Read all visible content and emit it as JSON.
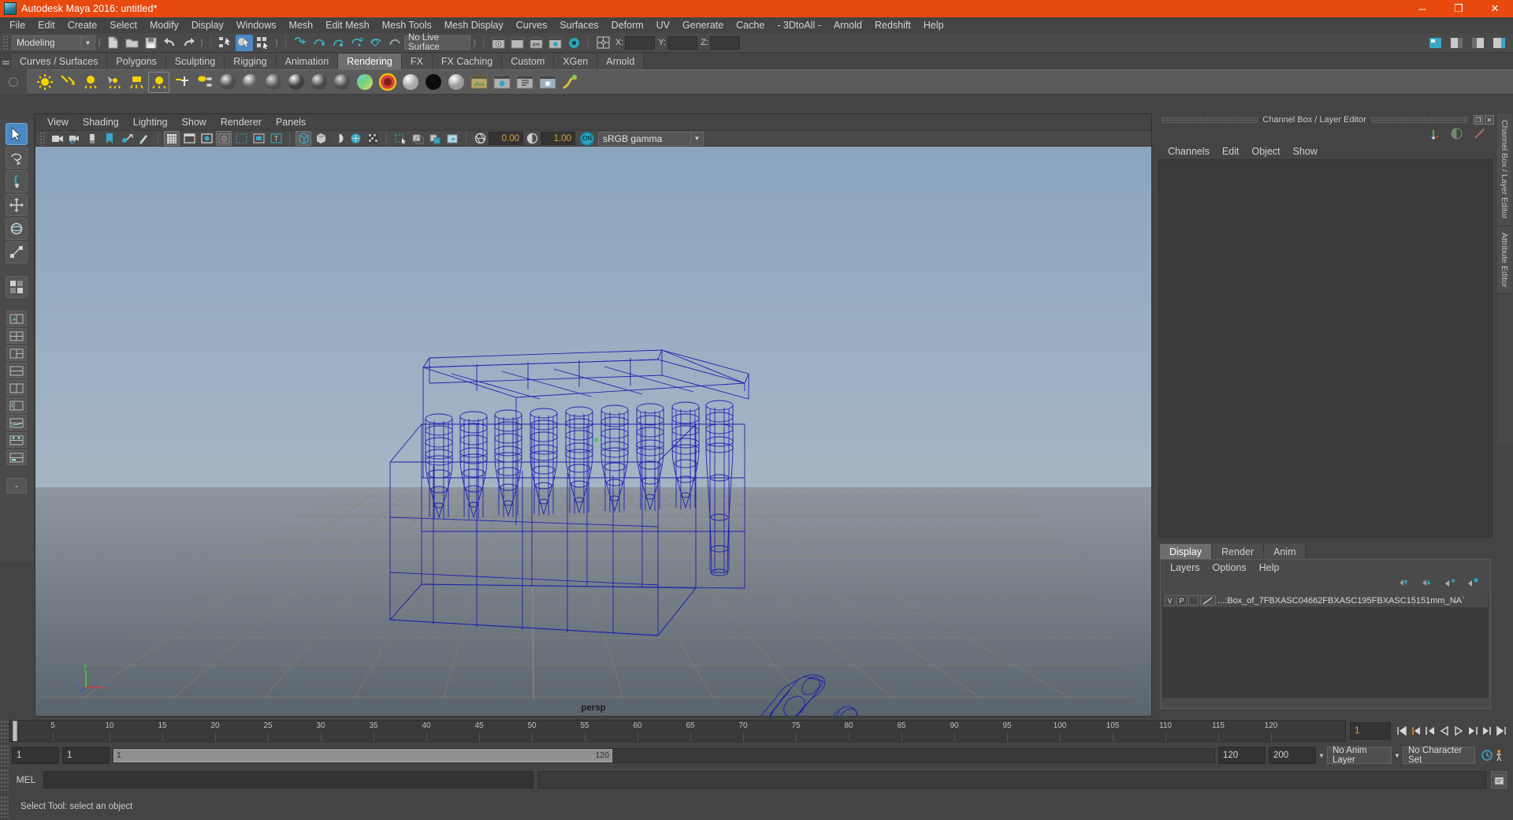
{
  "window": {
    "title": "Autodesk Maya 2016: untitled*",
    "app_icon": "maya-logo-icon",
    "buttons": [
      {
        "name": "minimize-button",
        "glyph": "─"
      },
      {
        "name": "maximize-button",
        "glyph": "❐"
      },
      {
        "name": "close-button",
        "glyph": "✕"
      }
    ],
    "titlebar_color": "#e8490f"
  },
  "menubar": {
    "items": [
      "File",
      "Edit",
      "Create",
      "Select",
      "Modify",
      "Display",
      "Windows",
      "Mesh",
      "Edit Mesh",
      "Mesh Tools",
      "Mesh Display",
      "Curves",
      "Surfaces",
      "Deform",
      "UV",
      "Generate",
      "Cache",
      "- 3DtoAll -",
      "Arnold",
      "Redshift",
      "Help"
    ]
  },
  "status_toolbar": {
    "menu_set": "Modeling",
    "live_surface": "No Live Surface",
    "coords": [
      {
        "label": "X:",
        "value": ""
      },
      {
        "label": "Y:",
        "value": ""
      },
      {
        "label": "Z:",
        "value": ""
      }
    ],
    "icons": [
      "new-scene-icon",
      "open-scene-icon",
      "save-scene-icon",
      "undo-icon",
      "redo-icon",
      "select-by-hierarchy-icon",
      "select-by-object-icon",
      "select-by-component-icon",
      "snap-to-grid-icon",
      "snap-to-curve-icon",
      "snap-to-point-icon",
      "snap-to-projected-center-icon",
      "snap-to-view-plane-icon",
      "make-live-icon",
      "render-current-frame-icon",
      "irr-render-icon",
      "ipr-render-icon",
      "render-settings-icon",
      "hypershade-icon",
      "editor-layout-icon"
    ]
  },
  "shelf": {
    "tabs": [
      {
        "label": "Curves / Surfaces",
        "active": false
      },
      {
        "label": "Polygons",
        "active": false
      },
      {
        "label": "Sculpting",
        "active": false
      },
      {
        "label": "Rigging",
        "active": false
      },
      {
        "label": "Animation",
        "active": false
      },
      {
        "label": "Rendering",
        "active": true
      },
      {
        "label": "FX",
        "active": false
      },
      {
        "label": "FX Caching",
        "active": false
      },
      {
        "label": "Custom",
        "active": false
      },
      {
        "label": "XGen",
        "active": false
      },
      {
        "label": "Arnold",
        "active": false
      }
    ],
    "icons": [
      "ambient-light-icon",
      "directional-light-icon",
      "point-light-icon",
      "spot-light-icon",
      "area-light-icon",
      "volume-light-icon",
      "light-linking-icon",
      "light-manipulator-icon",
      "default-material-sphere-icon",
      "blinn-material-icon",
      "lambert-material-icon",
      "phong-material-icon",
      "phonge-material-icon",
      "anisotropic-material-icon",
      "layered-shader-icon",
      "ramp-shader-icon",
      "use-background-icon",
      "surface-shader-icon",
      "shading-map-icon",
      "render-view-icon",
      "render-settings-icon",
      "batch-render-icon",
      "hardware-render-icon",
      "paint-effects-icon"
    ]
  },
  "toolbox": {
    "items": [
      {
        "name": "select-tool",
        "active": true
      },
      {
        "name": "lasso-select-tool",
        "active": false
      },
      {
        "name": "paint-select-tool",
        "active": false
      },
      {
        "name": "move-tool",
        "active": false
      },
      {
        "name": "rotate-tool",
        "active": false
      },
      {
        "name": "scale-tool",
        "active": false
      },
      {
        "name": "last-tool-used",
        "active": false
      },
      {
        "name": "show-manipulator-tool",
        "active": false
      }
    ],
    "layouts": [
      "single-perspective-layout",
      "four-view-layout",
      "three-view-split-layout",
      "two-stacked-layout",
      "two-side-layout",
      "outliner-persp-layout",
      "persp-graph-layout",
      "hypershade-persp-layout",
      "persp-trax-layout"
    ]
  },
  "viewport": {
    "menus": [
      "View",
      "Shading",
      "Lighting",
      "Show",
      "Renderer",
      "Panels"
    ],
    "toolbar_icons": [
      "select-camera-icon",
      "lock-camera-icon",
      "camera-attributes-icon",
      "bookmark-icon",
      "image-plane-icon",
      "two-dimensional-pan-zoom-icon",
      "grid-icon",
      "film-gate-icon",
      "resolution-gate-icon",
      "gate-mask-icon",
      "film-origin-icon",
      "safe-action-icon",
      "safe-title-icon",
      "wireframe-icon",
      "smooth-shade-all-icon",
      "shaded-wireframe-icon",
      "textured-icon",
      "use-all-lights-icon",
      "shadows-icon",
      "ambient-occlusion-icon",
      "motion-blur-icon",
      "multisample-icon",
      "depth-of-field-icon",
      "isolate-select-icon",
      "xray-icon",
      "xray-joints-icon",
      "xray-active-components-icon",
      "exposure-icon",
      "gamma-icon"
    ],
    "exposure_value": "0.00",
    "gamma_value": "1.00",
    "color_management_toggle": "ON",
    "view_transform": "sRGB gamma",
    "camera_label": "persp",
    "axis_labels": {
      "x": "x",
      "y": "y",
      "z": "z"
    },
    "wireframe_color": "#1a1fb0",
    "grid_color": "#8a7a6a",
    "background_top": "#8ba4bd",
    "background_bottom": "#5f6971"
  },
  "right_panel": {
    "title": "Channel Box / Layer Editor",
    "window_buttons": [
      {
        "name": "undock-panel-button",
        "glyph": "❐"
      },
      {
        "name": "close-panel-button",
        "glyph": "✕"
      }
    ],
    "top_icons": [
      "show-manipulators-icon",
      "toggle-channel-icon",
      "toggle-keyframe-icon"
    ],
    "channel_menus": [
      "Channels",
      "Edit",
      "Object",
      "Show"
    ],
    "editor_tabs": [
      {
        "label": "Display",
        "active": true
      },
      {
        "label": "Render",
        "active": false
      },
      {
        "label": "Anim",
        "active": false
      }
    ],
    "layer_menus": [
      "Layers",
      "Options",
      "Help"
    ],
    "layer_buttons": [
      "move-layer-up-icon",
      "move-layer-down-icon",
      "new-layer-icon",
      "new-layer-from-selection-icon"
    ],
    "layers": [
      {
        "visibility": "V",
        "playback": "P",
        "shading": "",
        "name": "...:Box_of_7FBXASC04662FBXASC195FBXASC15151mm_NA`"
      }
    ],
    "side_tabs": [
      "Channel Box / Layer Editor",
      "Attribute Editor"
    ]
  },
  "timeline": {
    "start_visible": 1,
    "ticks": [
      5,
      10,
      15,
      20,
      25,
      30,
      35,
      40,
      45,
      50,
      55,
      60,
      65,
      70,
      75,
      80,
      85,
      90,
      95,
      100,
      105,
      110,
      115,
      120
    ],
    "current_frame": "1",
    "playback_buttons": [
      "go-to-start-icon",
      "step-back-keyframe-icon",
      "step-back-frame-icon",
      "play-backwards-icon",
      "play-forwards-icon",
      "step-forward-frame-icon",
      "step-forward-keyframe-icon",
      "go-to-end-icon"
    ]
  },
  "range_slider": {
    "anim_start": "1",
    "range_start": "1",
    "bar_start": "1",
    "bar_end": "120",
    "range_end": "120",
    "anim_end": "200",
    "anim_layer": "No Anim Layer",
    "character_set": "No Character Set",
    "buttons": [
      "auto-keyframe-icon",
      "animation-preferences-icon"
    ]
  },
  "command_line": {
    "label": "MEL",
    "input_value": "",
    "output_value": "",
    "script_editor_icon": "script-editor-icon"
  },
  "help_line": {
    "text": "Select Tool: select an object"
  }
}
